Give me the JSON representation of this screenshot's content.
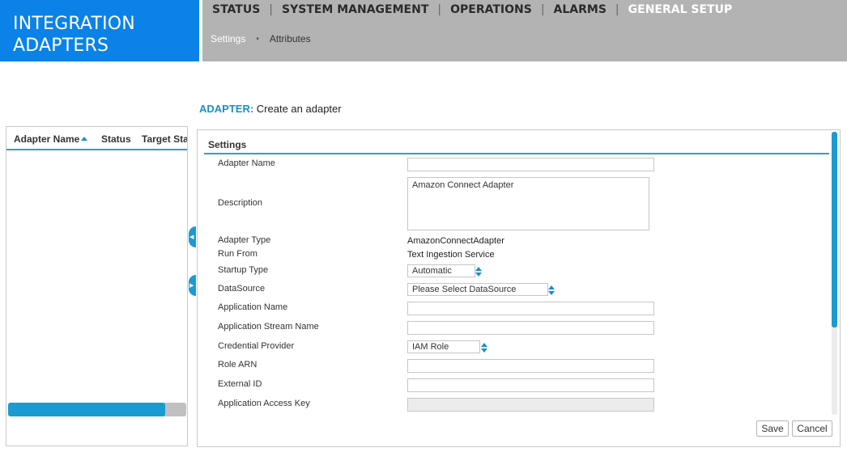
{
  "brand": {
    "line1": "INTEGRATION",
    "line2": "ADAPTERS"
  },
  "nav": {
    "items": [
      {
        "label": "STATUS"
      },
      {
        "label": "SYSTEM MANAGEMENT"
      },
      {
        "label": "OPERATIONS"
      },
      {
        "label": "ALARMS"
      },
      {
        "label": "GENERAL SETUP",
        "active": true
      }
    ],
    "separator": "|",
    "subitems": [
      {
        "label": "Settings",
        "active": true
      },
      {
        "label": "Attributes"
      }
    ],
    "subseparator": "•"
  },
  "heading": {
    "key": "ADAPTER:",
    "value": "Create an adapter"
  },
  "grid": {
    "columns": [
      "Adapter Name",
      "Status",
      "Target Sta"
    ],
    "sorted_column": "Adapter Name",
    "sort_direction": "ascending",
    "hscroll_fraction": 0.88
  },
  "form": {
    "section_title": "Settings",
    "labels": {
      "adapter_name": "Adapter Name",
      "description": "Description",
      "adapter_type": "Adapter Type",
      "run_from": "Run From",
      "startup_type": "Startup Type",
      "datasource": "DataSource",
      "application_name": "Application Name",
      "application_stream_name": "Application Stream Name",
      "credential_provider": "Credential Provider",
      "role_arn": "Role ARN",
      "external_id": "External ID",
      "application_access_key": "Application Access Key"
    },
    "values": {
      "adapter_name": "",
      "description": "Amazon Connect Adapter",
      "adapter_type": "AmazonConnectAdapter",
      "run_from": "Text Ingestion Service",
      "startup_type": "Automatic",
      "datasource": "Please Select DataSource",
      "application_name": "",
      "application_stream_name": "",
      "credential_provider": "IAM Role",
      "role_arn": "",
      "external_id": "",
      "application_access_key": ""
    },
    "vscroll_fraction": 0.69
  },
  "buttons": {
    "save": "Save",
    "cancel": "Cancel"
  },
  "colors": {
    "brand": "#0a82e8",
    "accent": "#1a9bd1",
    "nav_bg": "#b3b3b3"
  }
}
